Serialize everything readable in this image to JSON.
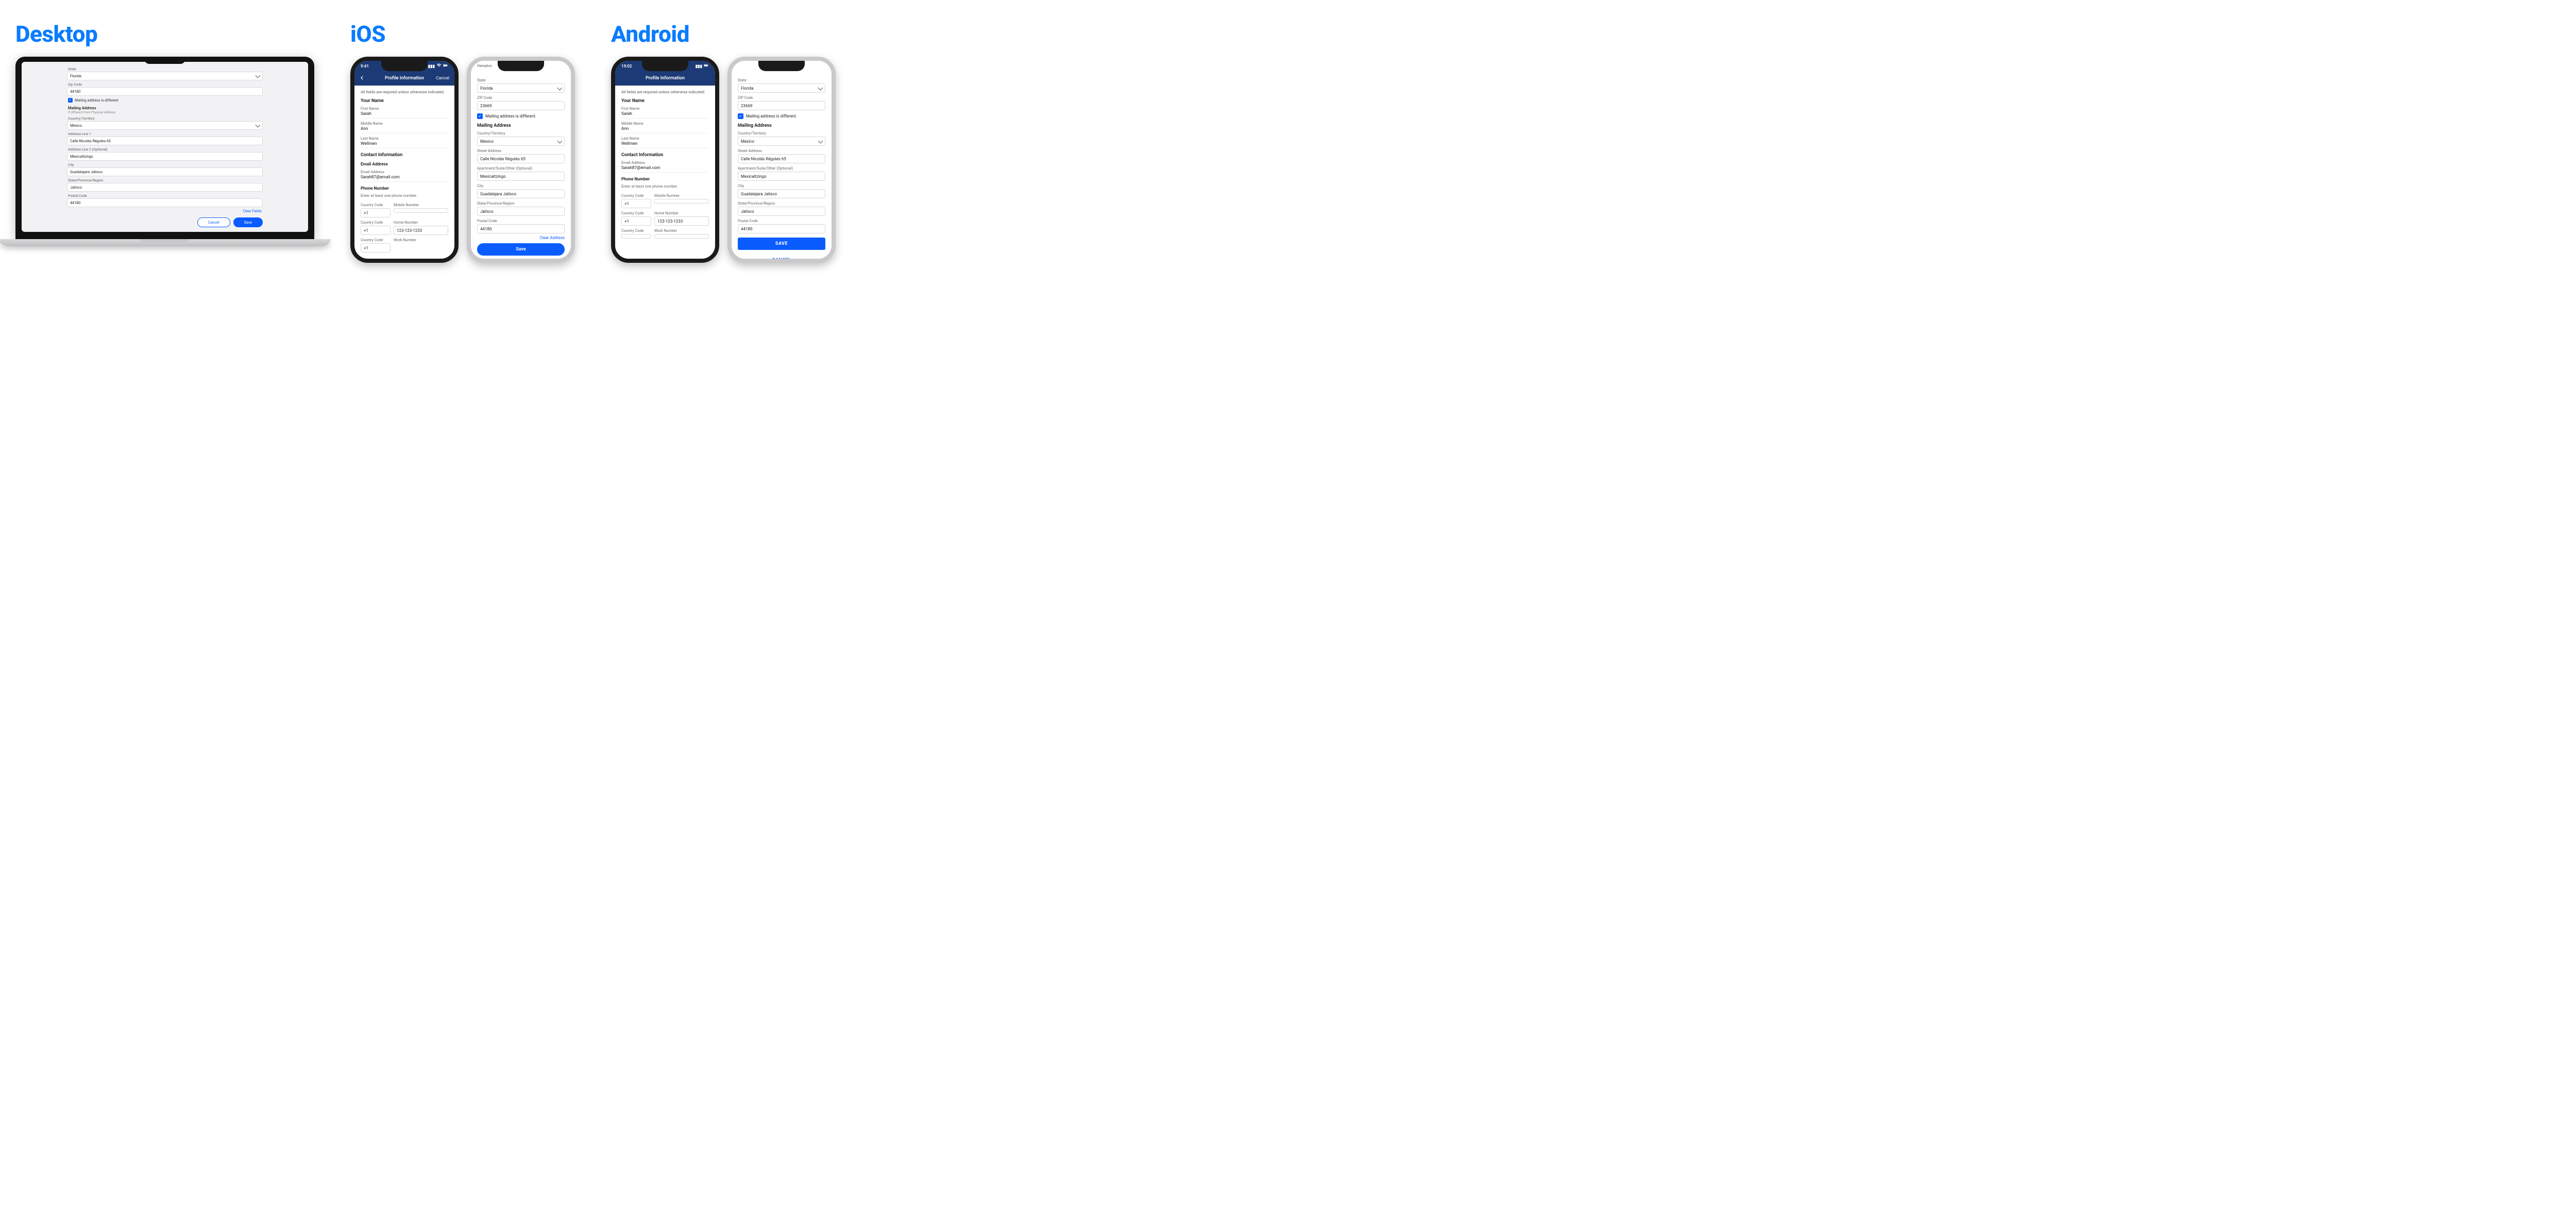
{
  "titles": {
    "desktop": "Desktop",
    "ios": "iOS",
    "android": "Android"
  },
  "desktop": {
    "state_label": "State",
    "state_value": "Florida",
    "zip_label": "Zip Code",
    "zip_value": "44180",
    "mailing_diff": "Mailing address is different",
    "mailing_header": "Mailing Address",
    "mailing_sub": "If different from Physical Address",
    "country_label": "Country/Territory",
    "country_value": "Mexico",
    "addr1_label": "Address Line 1",
    "addr1_value": "Calle Nicolás Régules 65",
    "addr2_label": "Address Line 2  (Optional)",
    "addr2_value": "Mexicaltzingo",
    "city_label": "City",
    "city_value": "Guadalajara Jalisco",
    "region_label": "State/Province/Region",
    "region_value": "Jalisco",
    "postal_label": "Postal Code",
    "postal_value": "44180",
    "clear_link": "Clear Fields",
    "cancel_btn": "Cancel",
    "save_btn": "Save"
  },
  "ios": {
    "phone1": {
      "time": "9:41",
      "title": "Profile Information",
      "cancel": "Cancel",
      "hint": "All fields are required unless otherwise indicated.",
      "your_name": "Your Name",
      "first_label": "First Name",
      "first_value": "Sarah",
      "middle_label": "Middle Name",
      "middle_value": "Ann",
      "last_label": "Last Name",
      "last_value": "Wellmen",
      "contact_header": "Contact Information",
      "email_section": "Email Address",
      "email_label": "Email Address",
      "email_value": "Sarah87@email.com",
      "phone_section": "Phone Number",
      "phone_hint": "Enter at least one phone number.",
      "cc_label": "Country Code",
      "mobile_label": "Mobile Number",
      "home_label": "Home Number",
      "work_label": "Work Number",
      "cc_value": "+1",
      "home_value": "123-123-1233"
    },
    "phone2": {
      "top_text": "Hampton",
      "state_label": "State",
      "state_value": "Florida",
      "zip_label": "ZIP Code",
      "zip_value": "23669",
      "mailing_diff": "Mailing address is different.",
      "mailing_header": "Mailing Address",
      "country_label": "Country/Territory",
      "country_value": "Mexico",
      "street_label": "Street Address",
      "street_value": "Calle Nicolás Régules 65",
      "apt_label": "Apartment/Suite/Other (Optional)",
      "apt_value": "Mexicaltzingo",
      "city_label": "City",
      "city_value": "Guadalajara Jalisco",
      "region_label": "State/Province/Region",
      "region_value": "Jalisco",
      "postal_label": "Postal Code",
      "postal_value": "44180",
      "clear_link": "Clear Address",
      "save_btn": "Save"
    }
  },
  "android": {
    "phone1": {
      "time": "19:02",
      "title": "Profile Information",
      "hint": "All fields are required unless otherwise indicated.",
      "your_name": "Your Name",
      "first_label": "First Name",
      "first_value": "Sarah",
      "middle_label": "Middle Name",
      "middle_value": "Ann",
      "last_label": "Last Name",
      "last_value": "Wellmen",
      "contact_header": "Contact Information",
      "email_label": "Email Address",
      "email_value": "Sarah87@email.com",
      "phone_section": "Phone Number",
      "phone_hint": "Enter at least one phone number.",
      "cc_label": "Country Code",
      "mobile_label": "Mobile Number",
      "home_label": "Home Number",
      "work_label": "Work Number",
      "cc_value": "+1",
      "home_value": "123-123-1233"
    },
    "phone2": {
      "state_label": "State",
      "state_value": "Florida",
      "zip_label": "ZIP Code",
      "zip_value": "23669",
      "mailing_diff": "Mailing address is different.",
      "mailing_header": "Mailing Address",
      "country_label": "Country/Territory",
      "country_value": "Mexico",
      "street_label": "Street Address",
      "street_value": "Calle Nicolás Régules 65",
      "apt_label": "Apartment/Suite/Other (Optional)",
      "apt_value": "Mexicaltzingo",
      "city_label": "City",
      "city_value": "Guadalajara Jalisco",
      "region_label": "State/Province/Region",
      "region_value": "Jalisco",
      "postal_label": "Postal Code",
      "postal_value": "44180",
      "save_btn": "SAVE",
      "cancel_btn": "CANCEL"
    }
  }
}
